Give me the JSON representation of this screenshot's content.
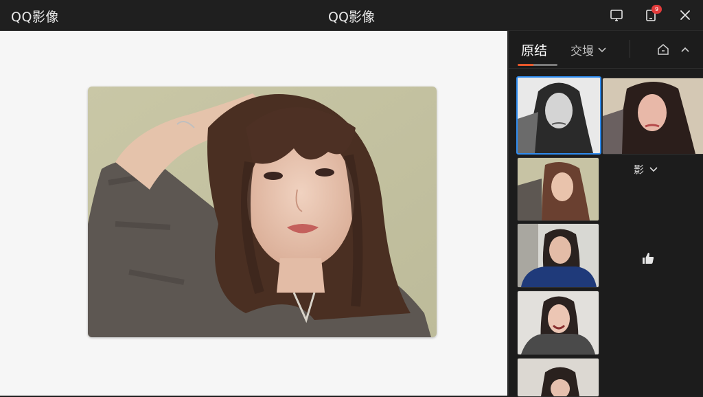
{
  "app": {
    "name": "QQ影像",
    "window_title": "QQ影像"
  },
  "titlebar": {
    "screen_icon": "monitor-icon",
    "device_icon": "device-icon",
    "device_badge": "9",
    "close_icon": "close-icon"
  },
  "panel": {
    "tab_original": "原结",
    "tab_compare": "交墁",
    "filter_label": "影",
    "home_icon": "home-icon",
    "collapse_icon": "chevron-up-icon",
    "like_icon": "thumbs-up-icon"
  },
  "colors": {
    "accent": "#e8582b",
    "selection": "#2f8cf0",
    "badge": "#e23b3b",
    "panel_bg": "#1c1c1c",
    "canvas_bg": "#f6f6f6"
  }
}
